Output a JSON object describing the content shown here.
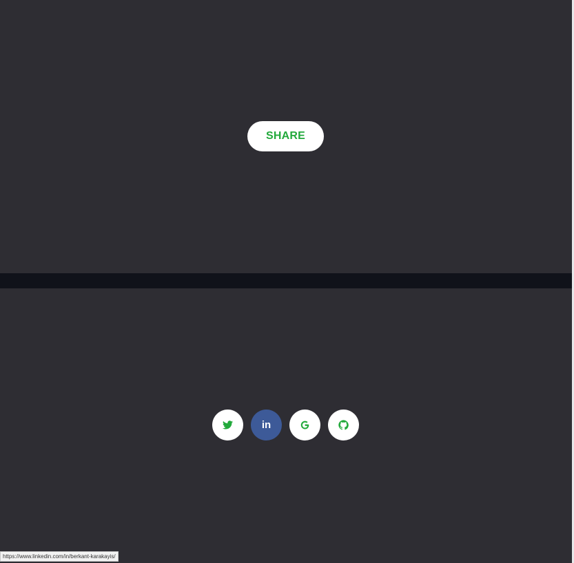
{
  "colors": {
    "background": "#2e2d33",
    "divider": "#10121a",
    "accent": "#22a93b",
    "linkedin": "#3d5a98"
  },
  "share": {
    "label": "SHARE"
  },
  "social": {
    "items": [
      {
        "name": "twitter",
        "icon": "twitter-icon"
      },
      {
        "name": "linkedin",
        "icon": "linkedin-icon",
        "text": "in",
        "state": "hovered"
      },
      {
        "name": "google",
        "icon": "google-icon",
        "text": "G"
      },
      {
        "name": "github",
        "icon": "github-icon"
      }
    ]
  },
  "status_bar": {
    "url": "https://www.linkedin.com/in/berkant-karakayis/"
  }
}
